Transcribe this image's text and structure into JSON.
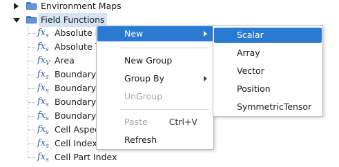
{
  "tree": {
    "items": [
      {
        "label": "Environment Maps",
        "kind": "folder",
        "expanded": false
      },
      {
        "label": "Field Functions",
        "kind": "folder",
        "expanded": true,
        "selected": true
      },
      {
        "label": "Absolute I",
        "kind": "function",
        "icon_sub": "s"
      },
      {
        "label": "Absolute T",
        "kind": "function",
        "icon_sub": "s"
      },
      {
        "label": "Area",
        "kind": "function",
        "icon_sub": "V"
      },
      {
        "label": "Boundary",
        "kind": "function",
        "icon_sub": "s"
      },
      {
        "label": "Boundary",
        "kind": "function",
        "icon_sub": "s"
      },
      {
        "label": "Boundary",
        "kind": "function",
        "icon_sub": "s"
      },
      {
        "label": "Boundary",
        "kind": "function",
        "icon_sub": "s"
      },
      {
        "label": "Cell Aspec",
        "kind": "function",
        "icon_sub": "s"
      },
      {
        "label": "Cell Index",
        "kind": "function",
        "icon_sub": "s"
      },
      {
        "label": "Cell Part Index",
        "kind": "function",
        "icon_sub": "s"
      }
    ],
    "fx_glyph": "fx"
  },
  "context_menu": {
    "new": "New",
    "new_group": "New Group",
    "group_by": "Group By",
    "ungroup": "UnGroup",
    "paste": "Paste",
    "paste_shortcut": "Ctrl+V",
    "refresh": "Refresh"
  },
  "submenu": {
    "items": [
      "Scalar",
      "Array",
      "Vector",
      "Position",
      "SymmetricTensor"
    ]
  },
  "colors": {
    "highlight": "#2a7ad4",
    "selection": "#d4e3f6",
    "folder": "#5e95d6",
    "fx_icon": "#3b5ea8"
  }
}
